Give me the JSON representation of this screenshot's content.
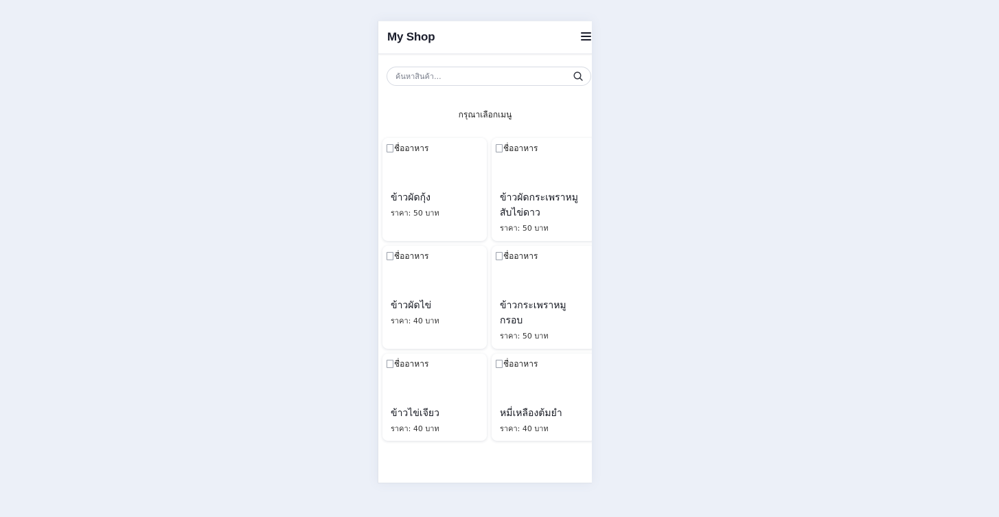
{
  "header": {
    "brand": "My Shop",
    "menu_icon": "hamburger-menu-icon"
  },
  "search": {
    "placeholder": "ค้นหาสินค้า...",
    "value": "",
    "icon": "search-icon"
  },
  "prompt": "กรุณาเลือกเมนู",
  "menu_items": [
    {
      "img_alt": "ชื่ออาหาร",
      "name": "ข้าวผัดกุ้ง",
      "price": "ราคา: 50 บาท"
    },
    {
      "img_alt": "ชื่ออาหาร",
      "name": "ข้าวผัดกระเพราหมูสับไข่ดาว",
      "price": "ราคา: 50 บาท"
    },
    {
      "img_alt": "ชื่ออาหาร",
      "name": "ข้าวผัดไข่",
      "price": "ราคา: 40 บาท"
    },
    {
      "img_alt": "ชื่ออาหาร",
      "name": "ข้าวกระเพราหมูกรอบ",
      "price": "ราคา: 50 บาท"
    },
    {
      "img_alt": "ชื่ออาหาร",
      "name": "ข้าวไข่เจียว",
      "price": "ราคา: 40 บาท"
    },
    {
      "img_alt": "ชื่ออาหาร",
      "name": "หมี่เหลืองต้มยำ",
      "price": "ราคา: 40 บาท"
    }
  ]
}
